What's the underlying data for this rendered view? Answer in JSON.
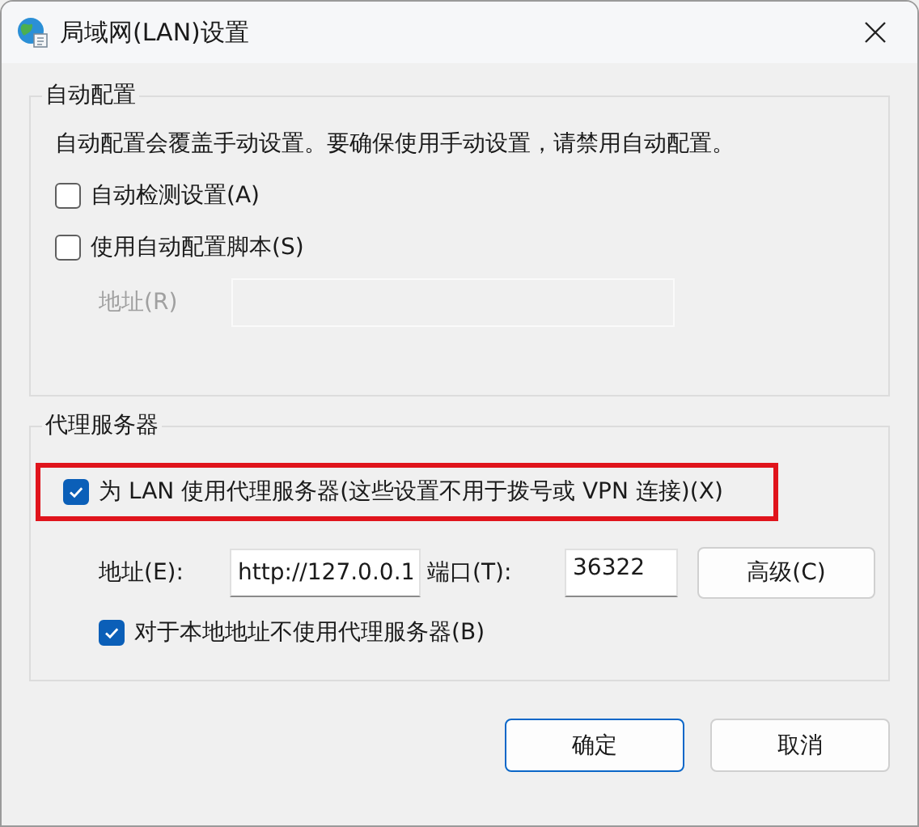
{
  "window": {
    "title": "局域网(LAN)设置"
  },
  "auto_config": {
    "title": "自动配置",
    "description": "自动配置会覆盖手动设置。要确保使用手动设置，请禁用自动配置。",
    "options": [
      {
        "label": "自动检测设置(A)",
        "checked": false
      },
      {
        "label": "使用自动配置脚本(S)",
        "checked": false
      }
    ],
    "address": {
      "label": "地址(R)",
      "disabled": true
    }
  },
  "proxy": {
    "title": "代理服务器",
    "use_proxy": {
      "label": "为 LAN 使用代理服务器(这些设置不用于拨号或 VPN 连接)(X)",
      "checked": true,
      "highlighted": true
    },
    "address": {
      "label": "地址(E):",
      "value": "http://127.0.0.1"
    },
    "port": {
      "label": "端口(T):",
      "value": "36322"
    },
    "advanced_button": "高级(C)",
    "bypass_local": {
      "label": "对于本地地址不使用代理服务器(B)",
      "checked": true
    }
  },
  "buttons": [
    {
      "label": "确定",
      "primary": true
    },
    {
      "label": "取消",
      "primary": false
    }
  ]
}
